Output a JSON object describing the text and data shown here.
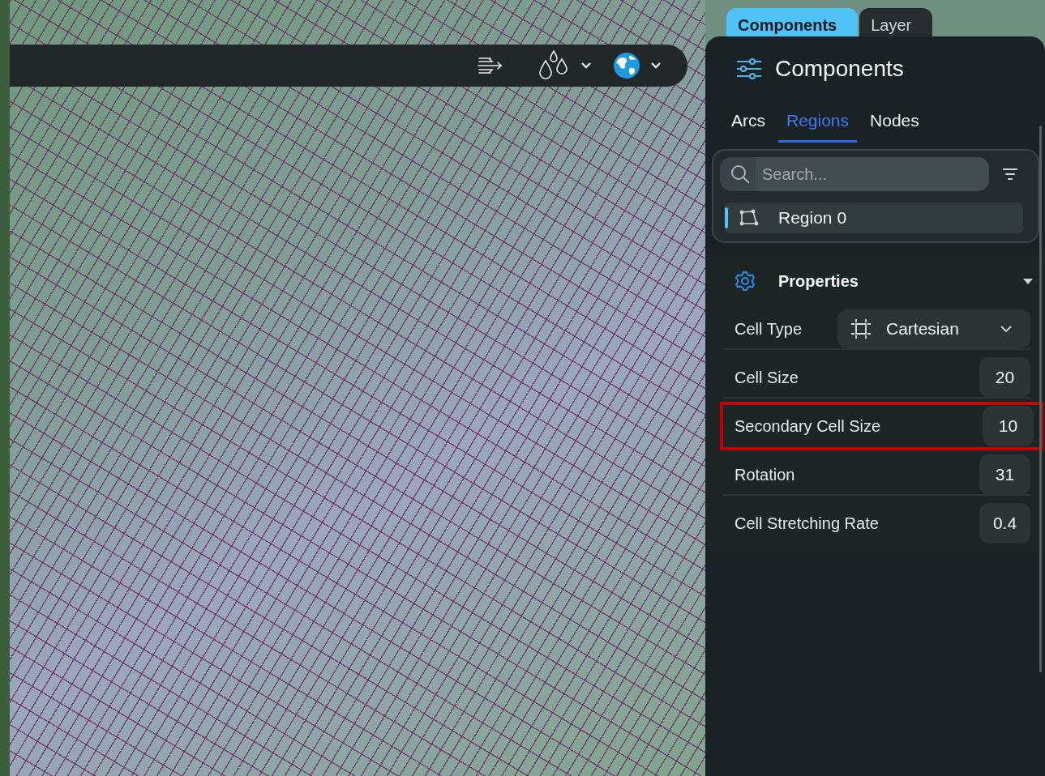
{
  "top_tabs": [
    {
      "label": "Components",
      "selected": true
    },
    {
      "label": "Layer",
      "selected": false
    }
  ],
  "panel": {
    "title": "Components"
  },
  "sub_tabs": [
    {
      "label": "Arcs",
      "selected": false
    },
    {
      "label": "Regions",
      "selected": true
    },
    {
      "label": "Nodes",
      "selected": false
    }
  ],
  "search": {
    "placeholder": "Search..."
  },
  "regions": [
    {
      "label": "Region 0",
      "selected": true
    }
  ],
  "properties": {
    "title": "Properties",
    "expanded": true,
    "items": [
      {
        "kind": "dropdown",
        "label": "Cell Type",
        "value": "Cartesian",
        "highlighted": false
      },
      {
        "kind": "number",
        "label": "Cell Size",
        "value": "20",
        "highlighted": false
      },
      {
        "kind": "number",
        "label": "Secondary Cell Size",
        "value": "10",
        "highlighted": true
      },
      {
        "kind": "number",
        "label": "Rotation",
        "value": "31",
        "highlighted": false
      },
      {
        "kind": "number",
        "label": "Cell Stretching Rate",
        "value": "0.4",
        "highlighted": false
      }
    ]
  }
}
